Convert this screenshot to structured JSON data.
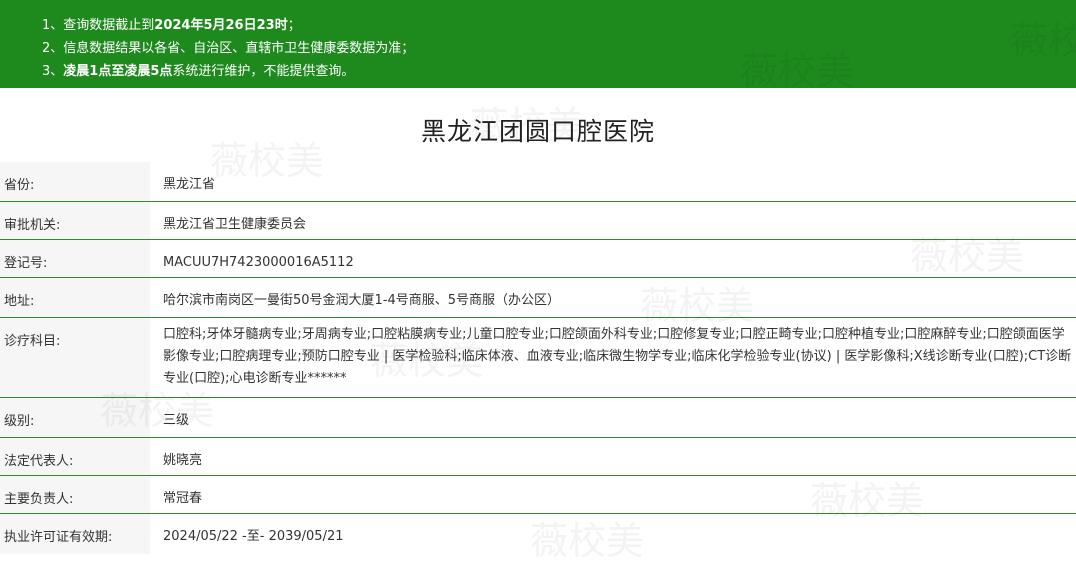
{
  "notice": {
    "line1_prefix": "1、查询数据截止到",
    "line1_bold": "2024年5月26日23时",
    "line1_suffix": "；",
    "line2": "2、信息数据结果以各省、自治区、直辖市卫生健康委数据为准；",
    "line3_prefix": "3、",
    "line3_bold": "凌晨1点至凌晨5点",
    "line3_suffix": "系统进行维护，不能提供查询。"
  },
  "hospital_name": "黑龙江团圆口腔医院",
  "fields": {
    "province": {
      "label": "省份:",
      "value": "黑龙江省"
    },
    "authority": {
      "label": "审批机关:",
      "value": "黑龙江省卫生健康委员会"
    },
    "reg_no": {
      "label": "登记号:",
      "value": "MACUU7H7423000016A5112"
    },
    "address": {
      "label": "地址:",
      "value": "哈尔滨市南岗区一曼街50号金润大厦1-4号商服、5号商服（办公区）"
    },
    "departments": {
      "label": "诊疗科目:",
      "value": "口腔科;牙体牙髓病专业;牙周病专业;口腔粘膜病专业;儿童口腔专业;口腔颌面外科专业;口腔修复专业;口腔正畸专业;口腔种植专业;口腔麻醉专业;口腔颌面医学影像专业;口腔病理专业;预防口腔专业 | 医学检验科;临床体液、血液专业;临床微生物学专业;临床化学检验专业(协议) | 医学影像科;X线诊断专业(口腔);CT诊断专业(口腔);心电诊断专业******"
    },
    "level": {
      "label": "级别:",
      "value": "三级"
    },
    "legal_rep": {
      "label": "法定代表人:",
      "value": "姚晓亮"
    },
    "principal": {
      "label": "主要负责人:",
      "value": "常冠春"
    },
    "validity": {
      "label": "执业许可证有效期:",
      "value": "2024/05/22 -至- 2039/05/21"
    }
  },
  "watermark": "薇校美"
}
